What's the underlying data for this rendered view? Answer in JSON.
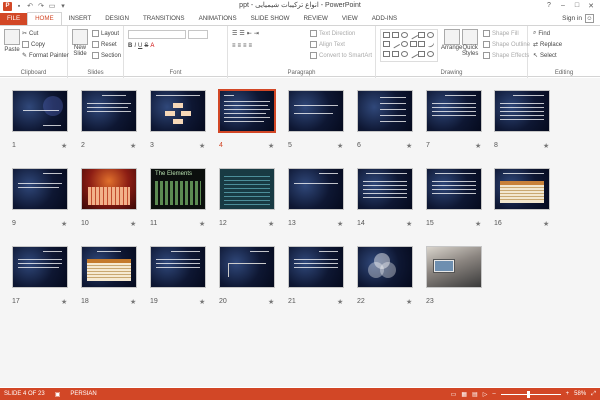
{
  "window": {
    "title": "ppt - انواع ترکیبات شیمیایی - PowerPoint",
    "app_badge": "P",
    "controls": [
      "?",
      "–",
      "□",
      "✕"
    ]
  },
  "ribbon_tabs": [
    {
      "label": "FILE"
    },
    {
      "label": "HOME"
    },
    {
      "label": "INSERT"
    },
    {
      "label": "DESIGN"
    },
    {
      "label": "TRANSITIONS"
    },
    {
      "label": "ANIMATIONS"
    },
    {
      "label": "SLIDE SHOW"
    },
    {
      "label": "REVIEW"
    },
    {
      "label": "VIEW"
    },
    {
      "label": "ADD-INS"
    }
  ],
  "account": {
    "label": "Sign in"
  },
  "ribbon": {
    "clipboard": {
      "label": "Clipboard",
      "paste": "Paste",
      "cut": "Cut",
      "copy": "Copy",
      "format_painter": "Format Painter"
    },
    "slides": {
      "label": "Slides",
      "new_slide": "New",
      "new_slide2": "Slide",
      "layout": "Layout",
      "reset": "Reset",
      "section": "Section"
    },
    "font": {
      "label": "Font"
    },
    "paragraph": {
      "label": "Paragraph",
      "text_direction": "Text Direction",
      "align_text": "Align Text",
      "smartart": "Convert to SmartArt"
    },
    "drawing": {
      "label": "Drawing",
      "arrange": "Arrange",
      "quick_styles": "Quick",
      "quick_styles2": "Styles",
      "shape_fill": "Shape Fill",
      "shape_outline": "Shape Outline",
      "shape_effects": "Shape Effects"
    },
    "editing": {
      "label": "Editing",
      "find": "Find",
      "replace": "Replace",
      "select": "Select"
    }
  },
  "slides": [
    {
      "number": "1",
      "transition": "★"
    },
    {
      "number": "2",
      "transition": "★"
    },
    {
      "number": "3",
      "transition": "★"
    },
    {
      "number": "4",
      "transition": "★"
    },
    {
      "number": "5",
      "transition": "★"
    },
    {
      "number": "6",
      "transition": "★"
    },
    {
      "number": "7",
      "transition": "★"
    },
    {
      "number": "8",
      "transition": "★"
    },
    {
      "number": "9",
      "transition": "★"
    },
    {
      "number": "10",
      "transition": "★"
    },
    {
      "number": "11",
      "transition": "★"
    },
    {
      "number": "12",
      "transition": "★"
    },
    {
      "number": "13",
      "transition": "★"
    },
    {
      "number": "14",
      "transition": "★"
    },
    {
      "number": "15",
      "transition": "★"
    },
    {
      "number": "16",
      "transition": "★"
    },
    {
      "number": "17",
      "transition": "★"
    },
    {
      "number": "18",
      "transition": "★"
    },
    {
      "number": "19",
      "transition": "★"
    },
    {
      "number": "20",
      "transition": "★"
    },
    {
      "number": "21",
      "transition": "★"
    },
    {
      "number": "22",
      "transition": "★"
    },
    {
      "number": "23",
      "transition": ""
    }
  ],
  "selected_slide": "4",
  "slide_texts": {
    "slide1_title": "انواع ترکیبات شیمیایی",
    "slide11_title": "The Elements"
  },
  "status": {
    "slide_info": "SLIDE 4 OF 23",
    "language": "PERSIAN",
    "zoom": "58%"
  },
  "colors": {
    "accent": "#d24726"
  }
}
